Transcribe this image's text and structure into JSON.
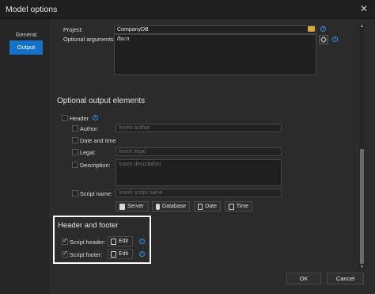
{
  "window": {
    "title": "Model options",
    "close_glyph": "✕"
  },
  "sidebar": {
    "items": [
      {
        "label": "General",
        "active": false
      },
      {
        "label": "Output",
        "active": true
      }
    ]
  },
  "project": {
    "label": "Project:",
    "value": "CompanyDB"
  },
  "optional_arguments": {
    "label": "Optional arguments:",
    "value": "/bu:n"
  },
  "optional_output": {
    "title": "Optional output elements",
    "header_label": "Header",
    "author": {
      "label": "Author:",
      "placeholder": "Insert author"
    },
    "date_time_label": "Date and time",
    "legal": {
      "label": "Legal:",
      "placeholder": "Insert legal"
    },
    "description": {
      "label": "Description:",
      "placeholder": "Insert description"
    },
    "script_name": {
      "label": "Script name:",
      "placeholder": "Insert script name"
    },
    "buttons": {
      "server": "Server",
      "database": "Database",
      "date": "Date",
      "time": "Time"
    }
  },
  "header_footer": {
    "title": "Header and footer",
    "script_header": {
      "label": "Script header:",
      "checked": true,
      "edit": "Edit"
    },
    "script_footer": {
      "label": "Script footer:",
      "checked": true,
      "edit": "Edit"
    }
  },
  "footer": {
    "ok": "OK",
    "cancel": "Cancel"
  },
  "icons": [
    "close-icon",
    "folder-icon",
    "info-icon",
    "link-icon",
    "server-icon",
    "database-icon",
    "calendar-icon",
    "clock-icon",
    "document-icon",
    "checkmark-icon",
    "scroll-up-icon",
    "scroll-down-icon"
  ],
  "colors": {
    "accent": "#1473c8",
    "info": "#2d8fe8",
    "highlight_border": "#ffffff"
  }
}
